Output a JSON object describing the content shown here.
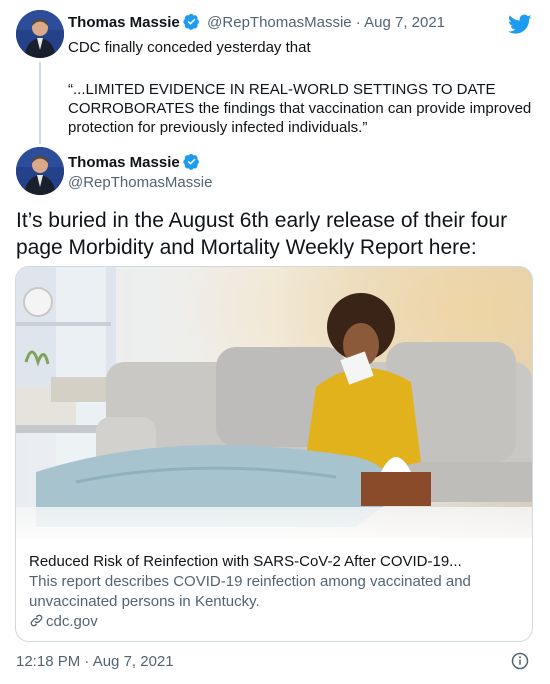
{
  "quoted_tweet": {
    "author_name": "Thomas Massie",
    "handle_and_date": "@RepThomasMassie · Aug 7, 2021",
    "line1": "CDC finally conceded yesterday that",
    "quote_line1": "“...LIMITED EVIDENCE IN REAL-WORLD SETTINGS TO DATE",
    "quote_line2": "CORROBORATES the findings that vaccination can provide improved",
    "quote_line3": "protection for previously infected individuals.”"
  },
  "main_tweet": {
    "author_name": "Thomas Massie",
    "handle": "@RepThomasMassie",
    "text_line1": "It’s buried in the August 6th early release of their four",
    "text_line2": "page Morbidity and Mortality Weekly Report here:"
  },
  "link_card": {
    "title": "Reduced Risk of Reinfection with SARS-CoV-2 After COVID-19...",
    "desc_line1": "This report describes COVID-19 reinfection among vaccinated and",
    "desc_line2": "unvaccinated persons in Kentucky.",
    "domain": "cdc.gov",
    "image_icon": "woman-sick-on-couch-photo"
  },
  "footer": {
    "timestamp": "12:18 PM · Aug 7, 2021",
    "info_icon": "info-icon"
  },
  "icons": {
    "brand": "twitter-bird-icon",
    "verified": "verified-badge-icon",
    "link": "link-icon"
  },
  "colors": {
    "twitter_blue": "#1d9bf0",
    "text": "#0f1419",
    "secondary": "#536471",
    "border": "#cfd9de"
  }
}
